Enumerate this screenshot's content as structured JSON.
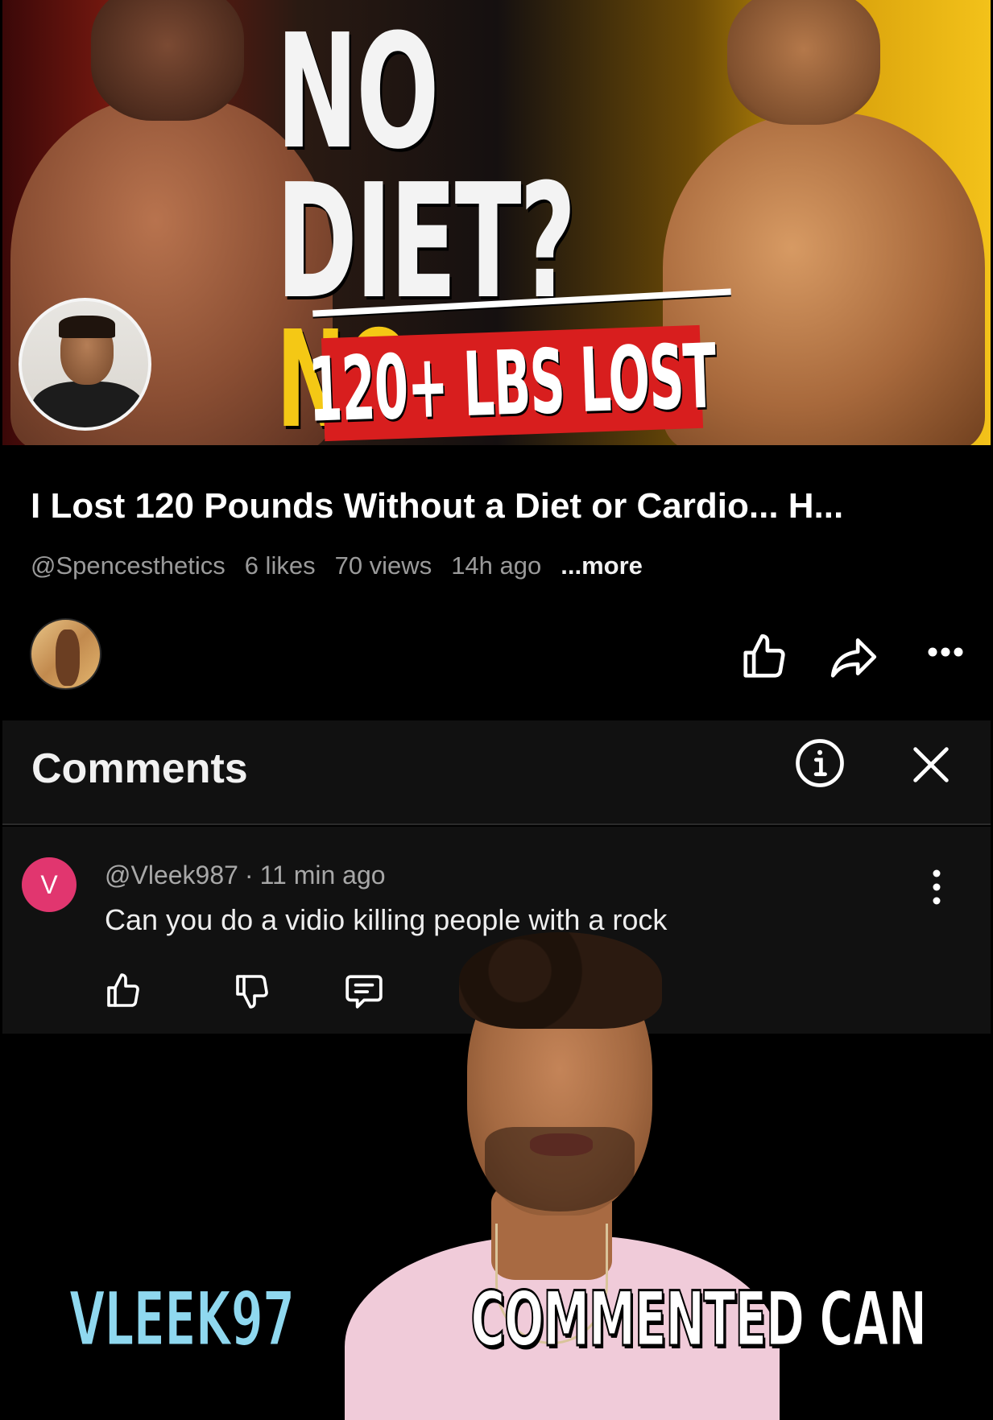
{
  "thumbnail": {
    "line1": "NO DIET?",
    "line2": "NO CARDIO?",
    "banner": "120+ LBS LOST"
  },
  "video": {
    "title": "I Lost 120 Pounds Without a Diet or Cardio... H...",
    "channel": "@Spencesthetics",
    "likes": "6 likes",
    "views": "70 views",
    "age": "14h ago",
    "more": "...more"
  },
  "actions": {
    "like_icon": "thumbs-up-icon",
    "share_icon": "share-icon",
    "menu_icon": "more-horizontal-icon"
  },
  "comments": {
    "title": "Comments",
    "info_icon": "info-icon",
    "close_icon": "close-icon",
    "items": [
      {
        "avatar_letter": "V",
        "avatar_color": "#e1366f",
        "author": "@Vleek987",
        "separator": "·",
        "time": "11 min ago",
        "text": "Can you do a vidio killing people with a rock"
      }
    ]
  },
  "caption": {
    "highlight": "VLEEK97",
    "rest": "COMMENTED CAN"
  },
  "colors": {
    "background": "#000000",
    "panel": "#111111",
    "accent_yellow": "#f4c815",
    "accent_red": "#d81e1e",
    "caption_highlight": "#8fd8ef"
  }
}
